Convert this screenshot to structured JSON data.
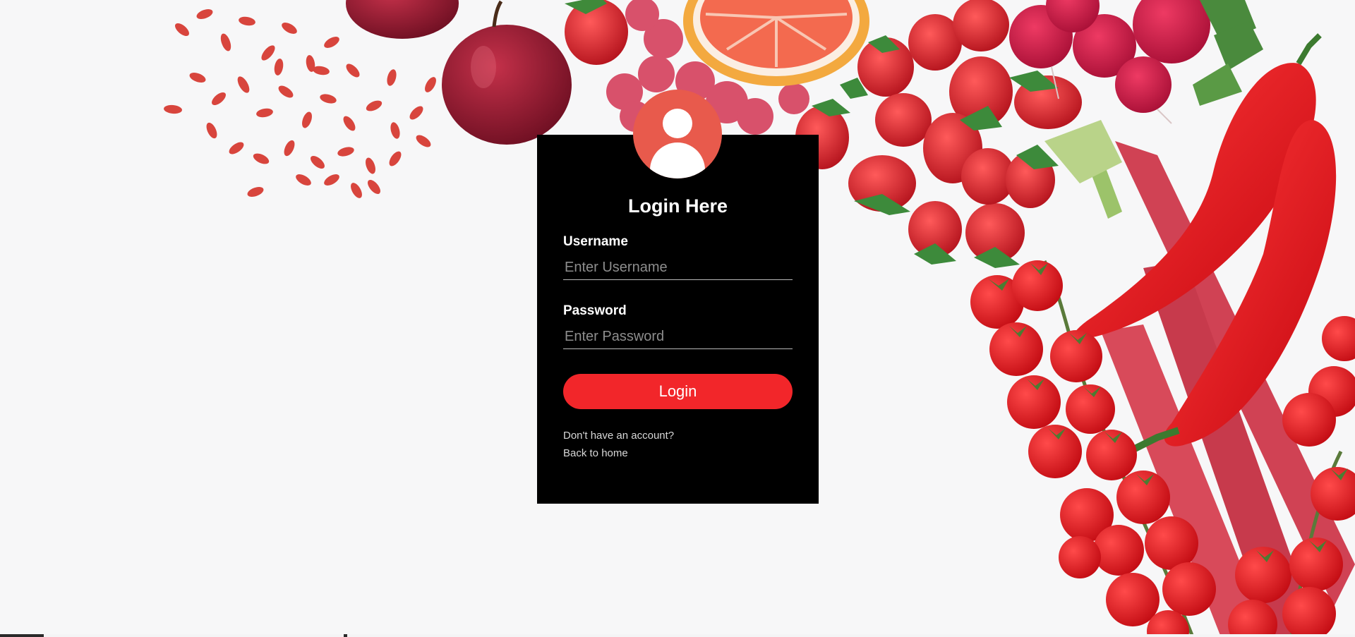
{
  "login_card": {
    "title": "Login Here",
    "username_label": "Username",
    "username_placeholder": "Enter Username",
    "username_value": "",
    "password_label": "Password",
    "password_placeholder": "Enter Password",
    "password_value": "",
    "login_button": "Login",
    "signup_link": "Don't have an account?",
    "home_link": "Back to home"
  },
  "icons": {
    "avatar": "user-avatar-icon"
  },
  "colors": {
    "card_background": "#000000",
    "avatar_background": "#e85a4c",
    "login_button": "#f2262a",
    "page_background": "#f7f7f8"
  }
}
